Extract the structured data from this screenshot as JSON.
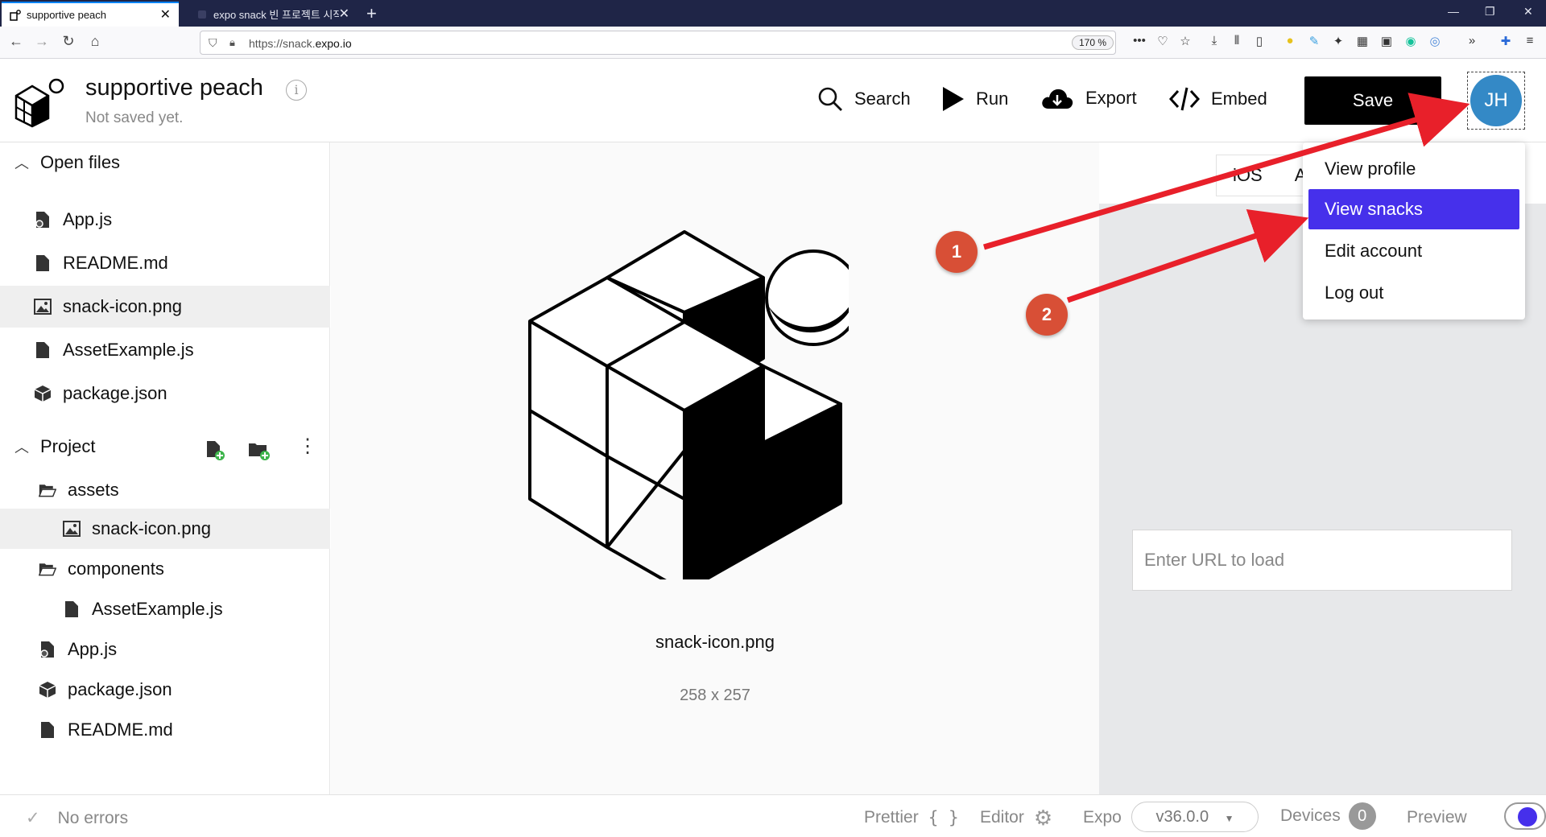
{
  "browser": {
    "tabs": [
      {
        "title": "supportive peach",
        "active": true
      },
      {
        "title": "expo snack 빈 프로젝트 시작하",
        "active": false
      }
    ],
    "url_prefix": "https://snack.",
    "url_domain": "expo.io",
    "zoom": "170 %"
  },
  "header": {
    "project_title": "supportive peach",
    "project_status": "Not saved yet.",
    "search_label": "Search",
    "run_label": "Run",
    "export_label": "Export",
    "embed_label": "Embed",
    "save_label": "Save",
    "avatar_initials": "JH"
  },
  "sidebar": {
    "open_files_label": "Open files",
    "open_files": [
      {
        "name": "App.js",
        "icon": "js-file-icon"
      },
      {
        "name": "README.md",
        "icon": "file-icon"
      },
      {
        "name": "snack-icon.png",
        "icon": "image-icon",
        "selected": true
      },
      {
        "name": "AssetExample.js",
        "icon": "file-icon"
      },
      {
        "name": "package.json",
        "icon": "package-icon"
      }
    ],
    "project_label": "Project",
    "project_tree": [
      {
        "name": "assets",
        "icon": "folder-icon",
        "depth": 0
      },
      {
        "name": "snack-icon.png",
        "icon": "image-icon",
        "depth": 1,
        "selected": true
      },
      {
        "name": "components",
        "icon": "folder-icon",
        "depth": 0
      },
      {
        "name": "AssetExample.js",
        "icon": "file-icon",
        "depth": 1
      },
      {
        "name": "App.js",
        "icon": "js-file-icon",
        "depth": 0
      },
      {
        "name": "package.json",
        "icon": "package-icon",
        "depth": 0
      },
      {
        "name": "README.md",
        "icon": "file-icon",
        "depth": 0
      }
    ]
  },
  "main": {
    "image_name": "snack-icon.png",
    "image_dims": "258 x 257"
  },
  "preview": {
    "device_tabs": [
      "iOS",
      "Ar"
    ],
    "url_placeholder": "Enter URL to load"
  },
  "user_menu": {
    "items": [
      "View profile",
      "View snacks",
      "Edit account",
      "Log out"
    ],
    "highlighted": "View snacks"
  },
  "footer": {
    "status": "No errors",
    "prettier_label": "Prettier",
    "editor_label": "Editor",
    "expo_label": "Expo",
    "sdk_version": "v36.0.0",
    "devices_label": "Devices",
    "devices_count": "0",
    "preview_label": "Preview"
  },
  "annotations": {
    "step1": "1",
    "step2": "2"
  },
  "colors": {
    "accent": "#4630eb",
    "avatar": "#3489c6",
    "annotation": "#d84f36",
    "arrow": "#e8202a"
  }
}
